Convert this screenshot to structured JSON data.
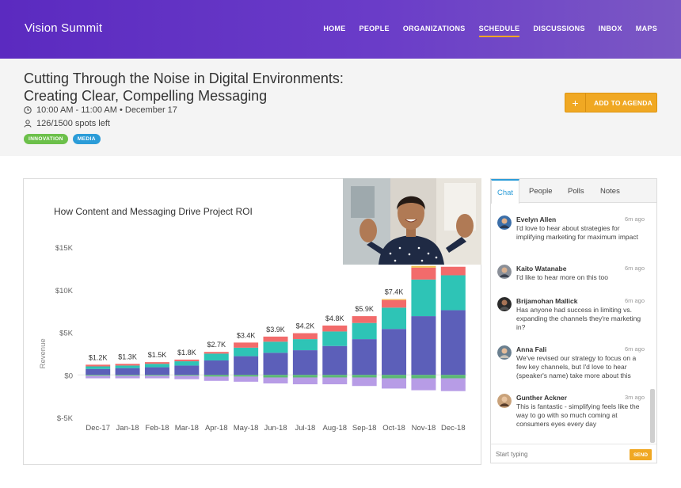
{
  "header": {
    "brand": "Vision Summit",
    "nav": [
      "HOME",
      "PEOPLE",
      "ORGANIZATIONS",
      "SCHEDULE",
      "DISCUSSIONS",
      "INBOX",
      "MAPS"
    ],
    "active_nav": "SCHEDULE",
    "accent_color": "#f5a623",
    "bg_color": "#5b2ac0"
  },
  "session": {
    "title": "Cutting Through the Noise in Digital Environments: Creating Clear, Compelling Messaging",
    "time": "10:00 AM - 11:00 AM • December 17",
    "spots": "126/1500 spots left",
    "tags": [
      {
        "label": "INNOVATION",
        "color": "#6cc04a"
      },
      {
        "label": "MEDIA",
        "color": "#2b9cd8"
      }
    ],
    "add_button": "ADD TO AGENDA",
    "add_icon": "+"
  },
  "chart_data": {
    "type": "bar",
    "title": "How Content and Messaging Drive Project ROI",
    "ylabel": "Revenue",
    "xlabel": "",
    "ylim": [
      -5000,
      15000
    ],
    "yticks": [
      "$-5K",
      "$0",
      "$5K",
      "$10K",
      "$15K"
    ],
    "ytick_values": [
      -5000,
      0,
      5000,
      10000,
      15000
    ],
    "categories": [
      "Dec-17",
      "Jan-18",
      "Feb-18",
      "Mar-18",
      "Apr-18",
      "May-18",
      "Jun-18",
      "Jul-18",
      "Aug-18",
      "Sep-18",
      "Oct-18",
      "Nov-18",
      "Dec-18"
    ],
    "totals_labels": [
      "$1.2K",
      "$1.3K",
      "$1.5K",
      "$1.8K",
      "$2.7K",
      "$3.4K",
      "$3.9K",
      "$4.2K",
      "$4.8K",
      "$5.9K",
      "$7.4K",
      "",
      ""
    ],
    "series": [
      {
        "color": "#5c5fb9",
        "values": [
          700,
          800,
          900,
          1100,
          1700,
          2200,
          2600,
          2900,
          3400,
          4200,
          5400,
          6900,
          7600
        ]
      },
      {
        "color": "#2ec4b6",
        "values": [
          300,
          300,
          400,
          500,
          800,
          1000,
          1300,
          1300,
          1700,
          1900,
          2500,
          4300,
          4100
        ]
      },
      {
        "color": "#f26b6b",
        "values": [
          200,
          200,
          200,
          200,
          200,
          600,
          600,
          700,
          700,
          800,
          900,
          1400,
          1000
        ]
      },
      {
        "color": "#f2c14e",
        "values": [
          0,
          0,
          0,
          0,
          0,
          0,
          0,
          0,
          0,
          0,
          100,
          200,
          0
        ]
      },
      {
        "color": "#5bb974",
        "values": [
          -100,
          -100,
          -100,
          -100,
          -200,
          -200,
          -300,
          -300,
          -300,
          -300,
          -400,
          -400,
          -400
        ]
      },
      {
        "color": "#b79ce6",
        "values": [
          -300,
          -300,
          -300,
          -400,
          -500,
          -600,
          -700,
          -800,
          -800,
          -1000,
          -1200,
          -1400,
          -1500
        ]
      }
    ],
    "grid": false
  },
  "chat": {
    "tabs": [
      "Chat",
      "People",
      "Polls",
      "Notes"
    ],
    "active_tab": "Chat",
    "messages": [
      {
        "name": "Evelyn Allen",
        "time": "6m ago",
        "text": "I'd love to hear about strategies for implifying marketing for maximum impact"
      },
      {
        "name": "Kaito Watanabe",
        "time": "6m ago",
        "text": "I'd like to hear more on this too"
      },
      {
        "name": "Brijamohan Mallick",
        "time": "6m ago",
        "text": "Has anyone had success in limiting vs. expanding the channels they're marketing in?"
      },
      {
        "name": "Anna Fali",
        "time": "6m ago",
        "text": "We've revised our strategy to focus on a few key channels, but I'd love to hear (speaker's name) take more about this"
      },
      {
        "name": "Gunther Ackner",
        "time": "3m ago",
        "text": "This is fantastic - simplifying feels like the way to go with so much coming at consumers eyes every day"
      }
    ],
    "placeholder": "Start typing",
    "send_label": "SEND"
  }
}
